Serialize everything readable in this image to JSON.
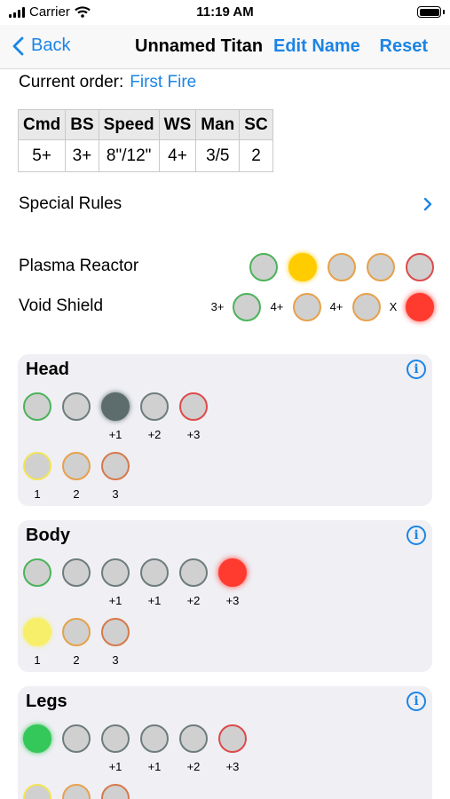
{
  "status_bar": {
    "carrier": "Carrier",
    "time": "11:19 AM"
  },
  "nav": {
    "back_label": "Back",
    "title": "Unnamed Titan",
    "edit_label": "Edit Name",
    "reset_label": "Reset"
  },
  "order": {
    "label": "Current order:",
    "value": "First Fire"
  },
  "stats": {
    "headers": [
      "Cmd",
      "BS",
      "Speed",
      "WS",
      "Man",
      "SC"
    ],
    "values": [
      "5+",
      "3+",
      "8\"/12\"",
      "4+",
      "3/5",
      "2"
    ]
  },
  "special_rules": {
    "label": "Special Rules"
  },
  "plasma_reactor": {
    "label": "Plasma Reactor"
  },
  "void_shield": {
    "label": "Void Shield",
    "thresholds": [
      "3+",
      "4+",
      "4+",
      "X"
    ]
  },
  "sections": {
    "head": {
      "title": "Head",
      "mods": [
        "+1",
        "+2",
        "+3"
      ],
      "crit": [
        "1",
        "2",
        "3"
      ]
    },
    "body": {
      "title": "Body",
      "mods": [
        "+1",
        "+1",
        "+2",
        "+3"
      ],
      "crit": [
        "1",
        "2",
        "3"
      ]
    },
    "legs": {
      "title": "Legs",
      "mods": [
        "+1",
        "+1",
        "+2",
        "+3"
      ]
    }
  },
  "icons": {
    "back": "chevron-left-icon",
    "disclosure": "chevron-right-icon",
    "info": "info-icon"
  },
  "colors": {
    "accent": "#1b84e6",
    "yellow": "#ffcc00",
    "red": "#ff3b30",
    "green": "#34c759"
  }
}
